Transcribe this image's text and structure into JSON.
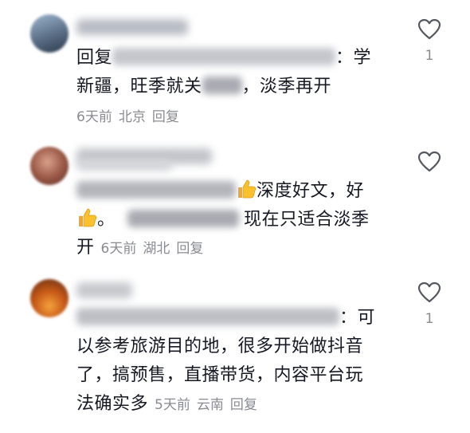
{
  "comments": [
    {
      "reply_prefix": "回复",
      "colon": "：",
      "text_line1_end": "学",
      "text_line2_a": "新疆，旺季就关",
      "text_line2_b": "，淡季再开",
      "days": "6天前",
      "location": "北京",
      "reply_label": "回复",
      "like_count": "1",
      "colors": {
        "avatar": "#5a6e86"
      }
    },
    {
      "text_line1": "深度好文，好",
      "text_line2_a": "。",
      "text_line2_b": "现在只适合淡季",
      "text_line3": "开",
      "days": "6天前",
      "location": "湖北",
      "reply_label": "回复",
      "like_count": "",
      "colors": {
        "avatar": "#8a4a3a"
      }
    },
    {
      "colon": "：",
      "text_line1_end": "可",
      "text_line2": "以参考旅游目的地，很多开始做抖音",
      "text_line3": "了，搞预售，直播带货，内容平台玩",
      "text_line4": "法确实多",
      "days": "5天前",
      "location": "云南",
      "reply_label": "回复",
      "like_count": "1",
      "colors": {
        "avatar": "#d36a1e"
      }
    }
  ],
  "icons": {
    "like": "heart-outline-icon",
    "emoji": "thumbs-up-emoji-icon"
  },
  "colors": {
    "text": "#161823",
    "meta": "#8a8b91",
    "blur": "#c9c9ce"
  }
}
